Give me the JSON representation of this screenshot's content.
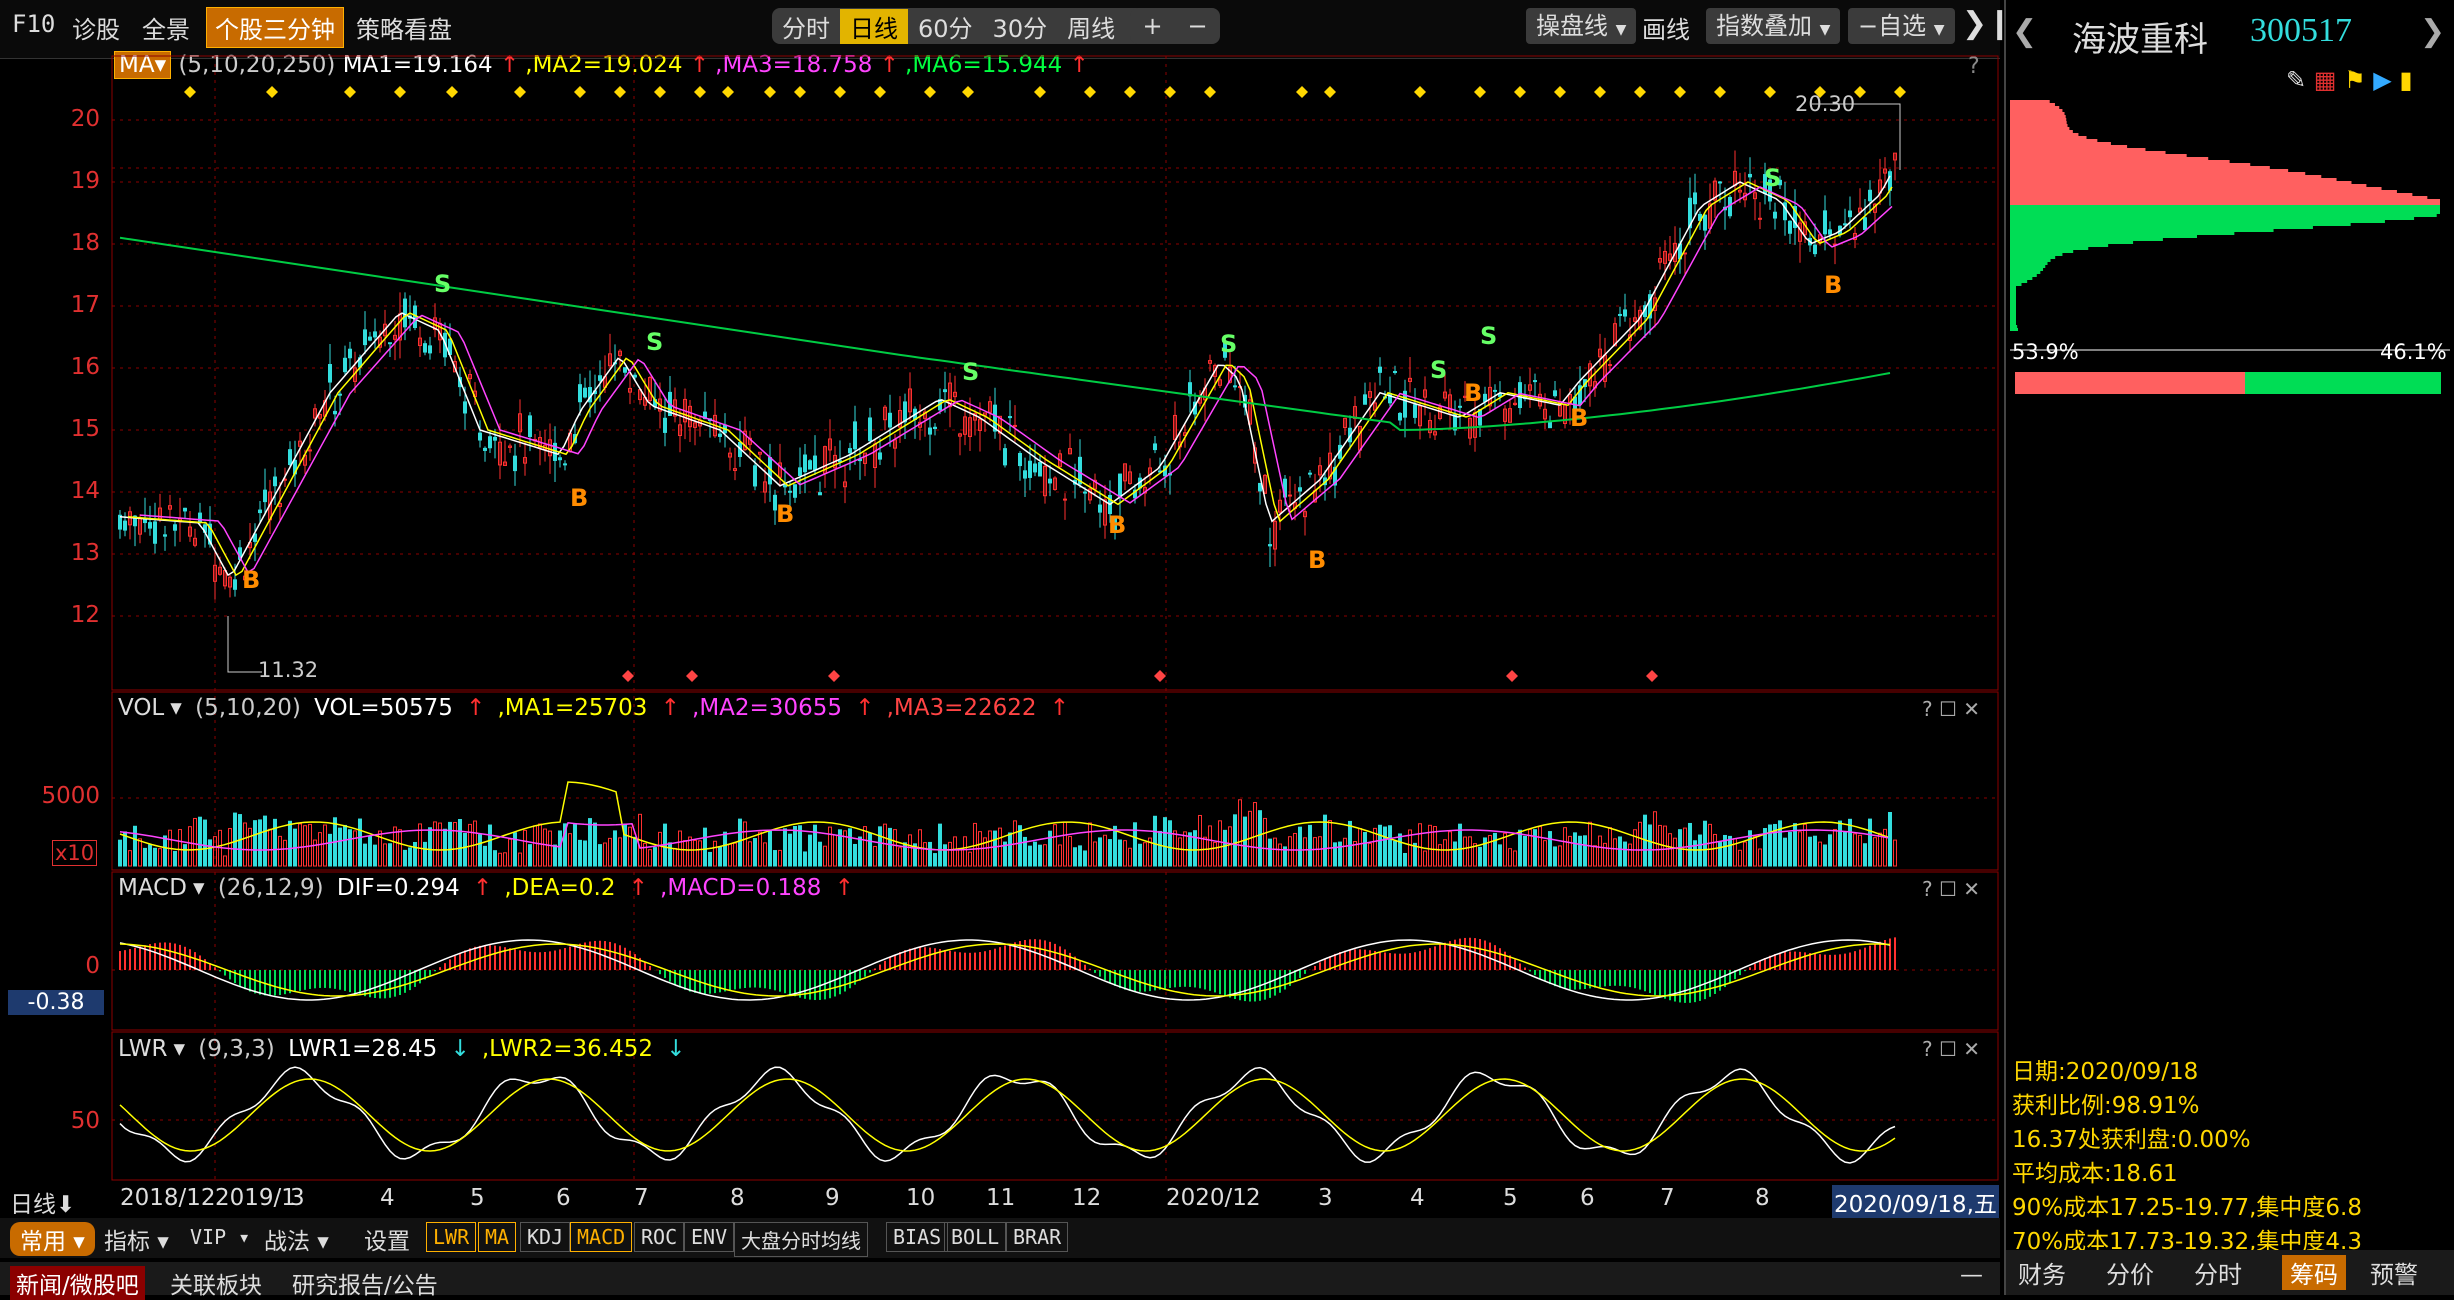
{
  "toolbar": {
    "f10": "F10",
    "diagnose": "诊股",
    "fullview": "全景",
    "intraday_3min": "个股三分钟",
    "strategy": "策略看盘",
    "periods": [
      "分时",
      "日线",
      "60分",
      "30分",
      "周线"
    ],
    "period_selected": 1,
    "zoom_in": "+",
    "zoom_out": "−",
    "trade_line": "操盘线",
    "draw": "画线",
    "index_overlay": "指数叠加",
    "self_select": "−自选"
  },
  "main_indicator": {
    "name": "MA",
    "params": "(5,10,20,250)",
    "items": [
      {
        "label": "MA1=19.164",
        "arrow": "↑",
        "color": "#ffffff"
      },
      {
        "label": ",MA2=19.024",
        "arrow": "↑",
        "color": "#ffff00"
      },
      {
        "label": ",MA3=18.758",
        "arrow": "↑",
        "color": "#ff44ff"
      },
      {
        "label": ",MA6=15.944",
        "arrow": "↑",
        "color": "#00ff40"
      }
    ],
    "help": "?"
  },
  "price_axis": [
    "20",
    "19",
    "18",
    "17",
    "16",
    "15",
    "14",
    "13",
    "12"
  ],
  "annotations": {
    "high": "20.30",
    "low": "11.32"
  },
  "vol_indicator": {
    "name": "VOL",
    "params": "(5,10,20)",
    "items": [
      {
        "label": "VOL=50575",
        "arrow": "↑",
        "color": "#ffffff"
      },
      {
        "label": ",MA1=25703",
        "arrow": "↑",
        "color": "#ffff00"
      },
      {
        "label": ",MA2=30655",
        "arrow": "↑",
        "color": "#ff44ff"
      },
      {
        "label": ",MA3=22622",
        "arrow": "↑",
        "color": "#ff4444"
      }
    ],
    "axis": [
      "5000"
    ],
    "unit": "x10"
  },
  "macd_indicator": {
    "name": "MACD",
    "params": "(26,12,9)",
    "items": [
      {
        "label": "DIF=0.294",
        "arrow": "↑",
        "color": "#ffffff"
      },
      {
        "label": ",DEA=0.2",
        "arrow": "↑",
        "color": "#ffff00"
      },
      {
        "label": ",MACD=0.188",
        "arrow": "↑",
        "color": "#ff44ff"
      }
    ],
    "axis": [
      "0"
    ],
    "cursor_value": "-0.38"
  },
  "lwr_indicator": {
    "name": "LWR",
    "params": "(9,3,3)",
    "items": [
      {
        "label": "LWR1=28.45",
        "arrow": "↓",
        "color": "#ffffff"
      },
      {
        "label": ",LWR2=36.452",
        "arrow": "↓",
        "color": "#ffff00"
      }
    ],
    "axis": [
      "50"
    ]
  },
  "x_axis": {
    "period_label": "日线",
    "labels": [
      "2018/12",
      "2019/1",
      "3",
      "4",
      "5",
      "6",
      "7",
      "8",
      "9",
      "10",
      "11",
      "12",
      "2020/1",
      "2",
      "3",
      "4",
      "5",
      "6",
      "7",
      "8"
    ],
    "cursor_date": "2020/09/18,五"
  },
  "bottom_tabs": {
    "common": "常用",
    "indicator": "指标",
    "vip": "VIP",
    "tactic": "战法",
    "settings": "设置",
    "ind_tabs": [
      "LWR",
      "MA",
      "KDJ",
      "MACD",
      "ROC",
      "ENV",
      "大盘分时均线",
      "BIAS",
      "BOLL",
      "BRAR"
    ],
    "ind_selected": [
      0,
      1,
      3
    ],
    "news": "新闻/微股吧",
    "sector": "关联板块",
    "report": "研究报告/公告"
  },
  "stock": {
    "name": "海波重科",
    "code": "300517"
  },
  "chip": {
    "profit_pct": "53.9%",
    "loss_pct": "46.1%",
    "date": "日期:2020/09/18",
    "profit_ratio": "获利比例:98.91%",
    "profit_at": "16.37处获利盘:0.00%",
    "avg_cost": "平均成本:18.61",
    "cost90": "90%成本17.25-19.77,集中度6.8",
    "cost70": "70%成本17.73-19.32,集中度4.3"
  },
  "right_tabs": [
    "财务",
    "分价",
    "分时",
    "筹码",
    "预警"
  ],
  "right_tab_selected": 3,
  "colors": {
    "up": "#ff3030",
    "down": "#33dddd",
    "ma1": "#ffffff",
    "ma2": "#ffff00",
    "ma3": "#ff44ff",
    "ma6": "#00cc44",
    "grid": "#8b0000"
  }
}
